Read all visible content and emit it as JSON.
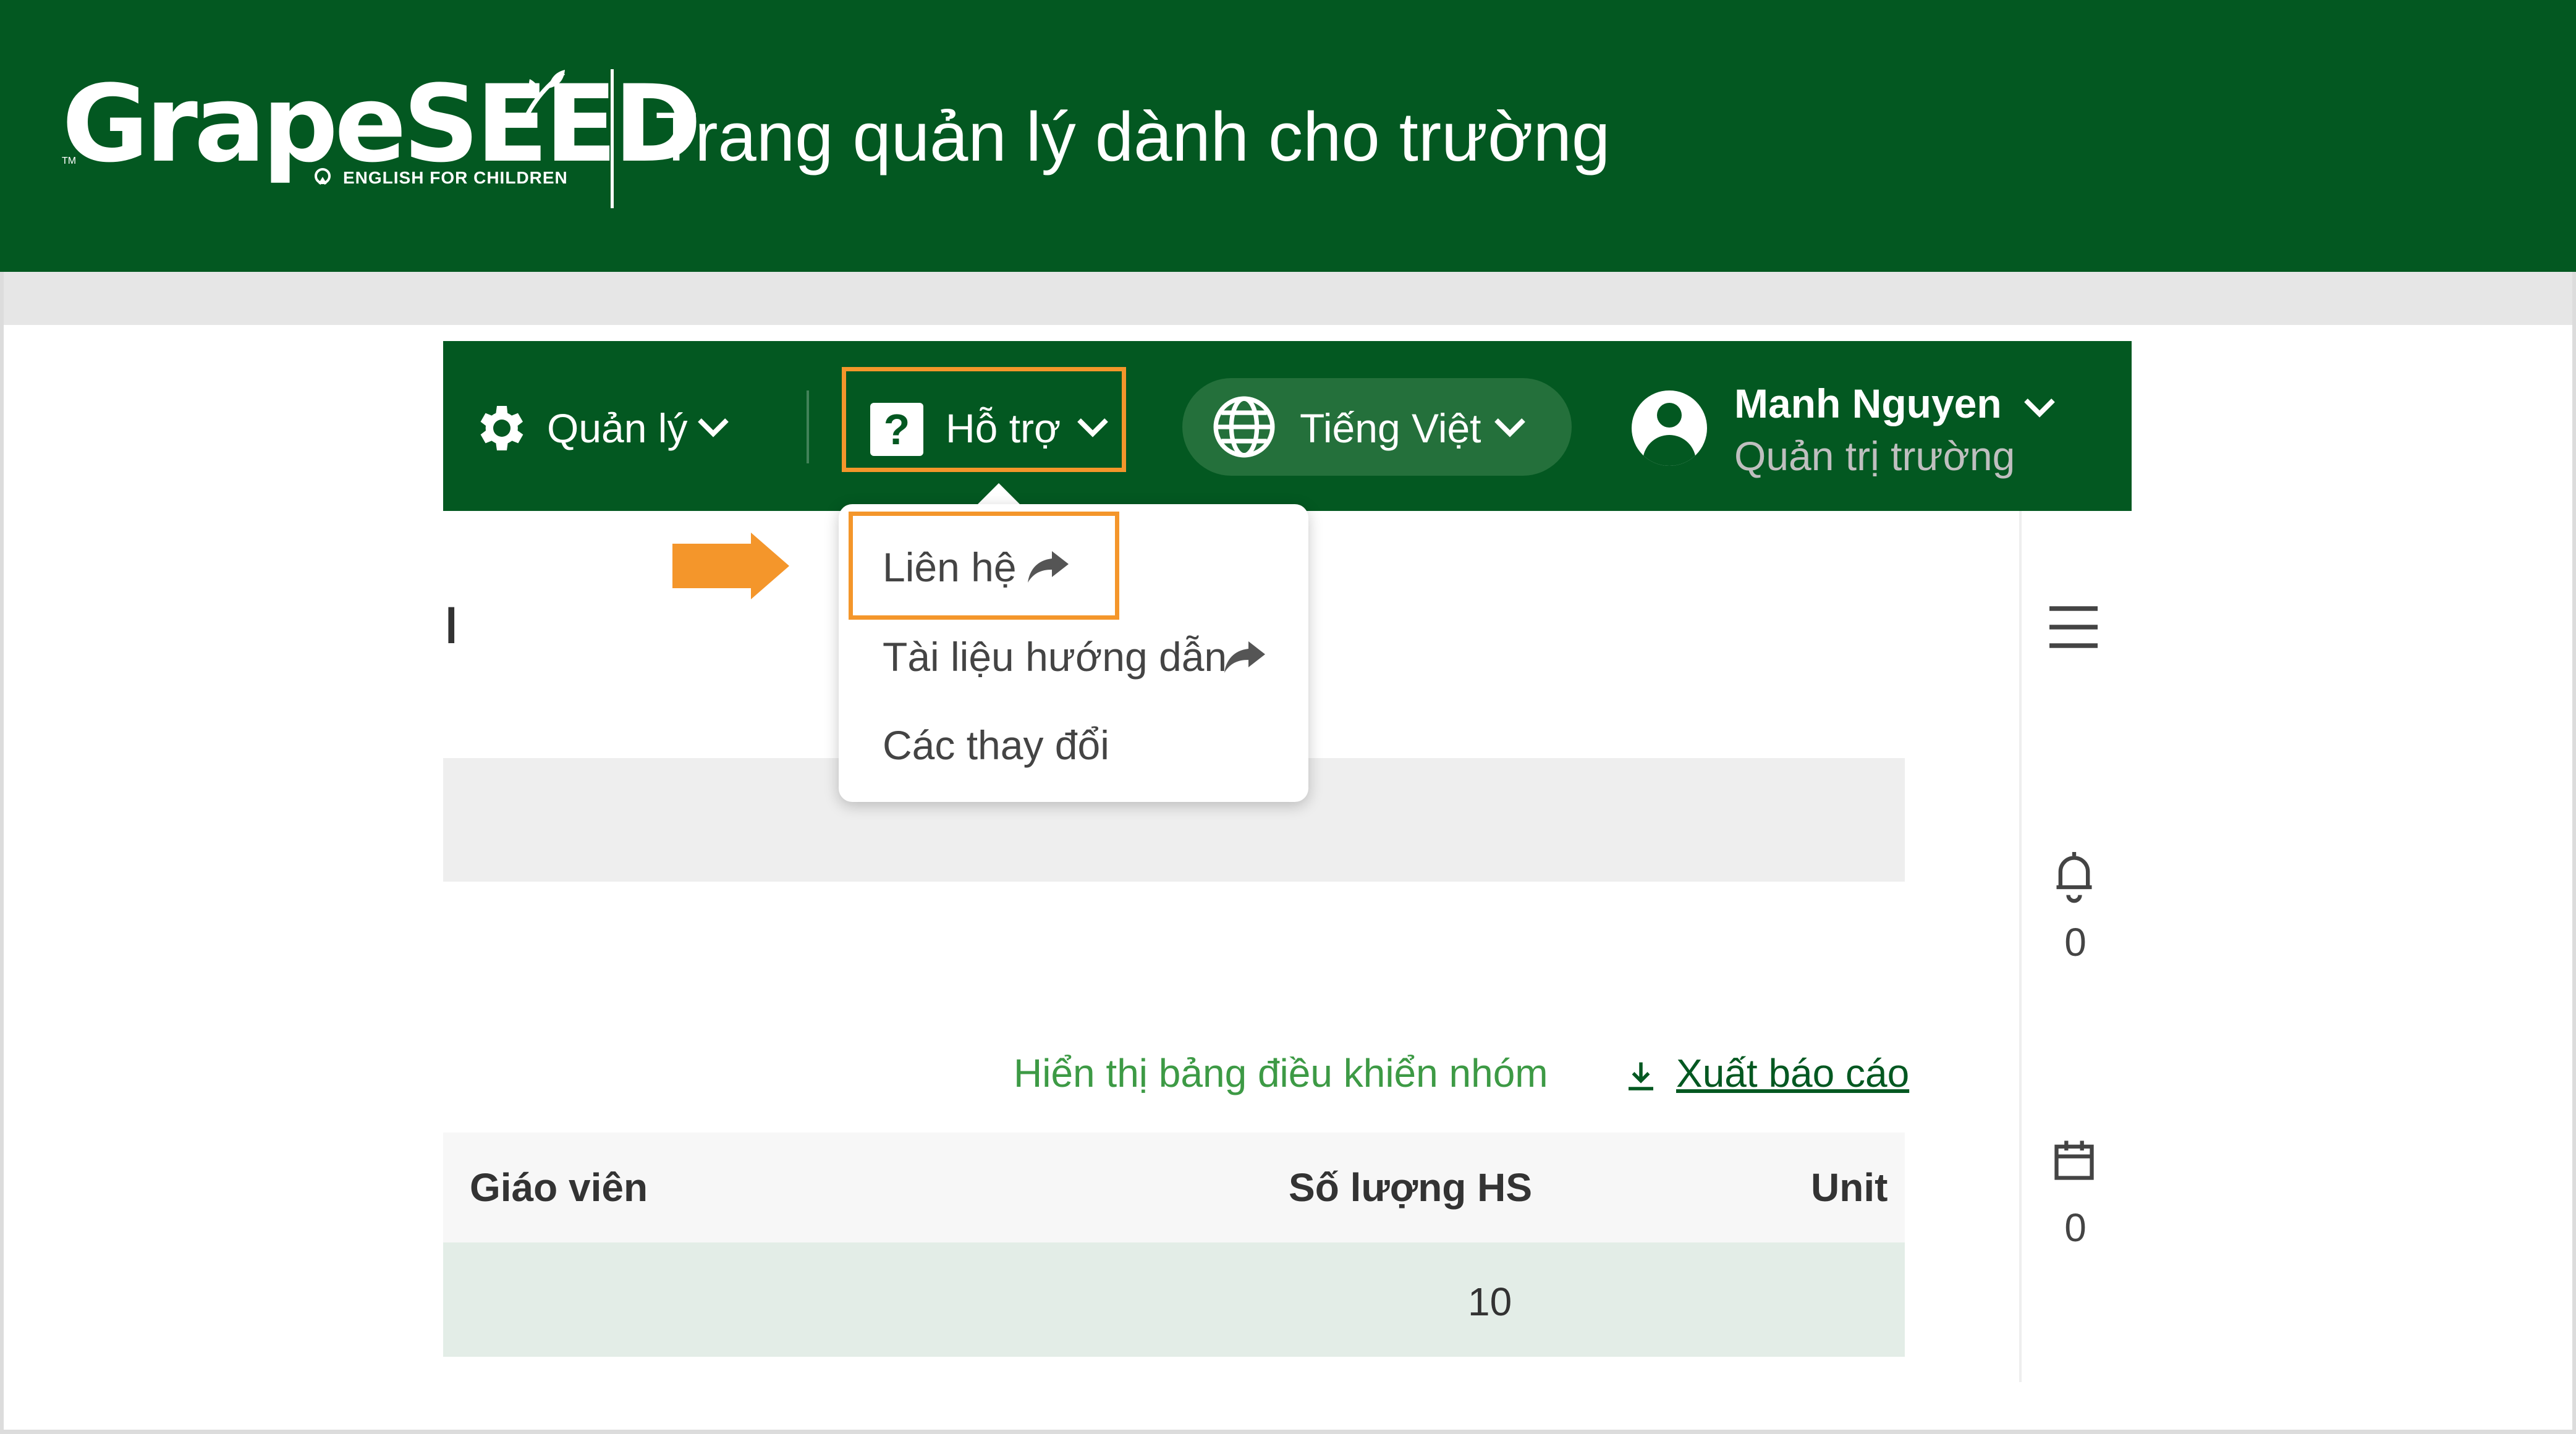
{
  "header": {
    "logo_text": "GrapeSEED",
    "logo_tagline": "ENGLISH FOR CHILDREN",
    "logo_tm": "TM",
    "title": "Trang quản lý dành cho trường",
    "bg_color": "#035821"
  },
  "navbar": {
    "manage_label": "Quản lý",
    "help_label": "Hỗ trợ",
    "help_icon_char": "?",
    "language_label": "Tiếng Việt",
    "user_name": "Manh Nguyen",
    "user_role": "Quản trị trường"
  },
  "support_menu": {
    "items": [
      {
        "label": "Liên hệ",
        "external": true,
        "highlighted": true
      },
      {
        "label": "Tài liệu hướng dẫn",
        "external": true
      },
      {
        "label": "Các thay đổi",
        "external": false
      }
    ]
  },
  "page": {
    "partial_title_char": "ı",
    "group_dashboard_link": "Hiển thị bảng điều khiển nhóm",
    "export_label": "Xuất báo cáo",
    "table": {
      "columns": [
        "Giáo viên",
        "Số lượng HS",
        "Unit"
      ],
      "rows": [
        {
          "teacher": "",
          "student_count": "10",
          "unit": ""
        }
      ]
    }
  },
  "right_rail": {
    "notifications_count": "0",
    "calendar_count": "0"
  },
  "colors": {
    "brand_green": "#035821",
    "highlight_orange": "#f4962b",
    "link_green": "#3d9a45"
  }
}
